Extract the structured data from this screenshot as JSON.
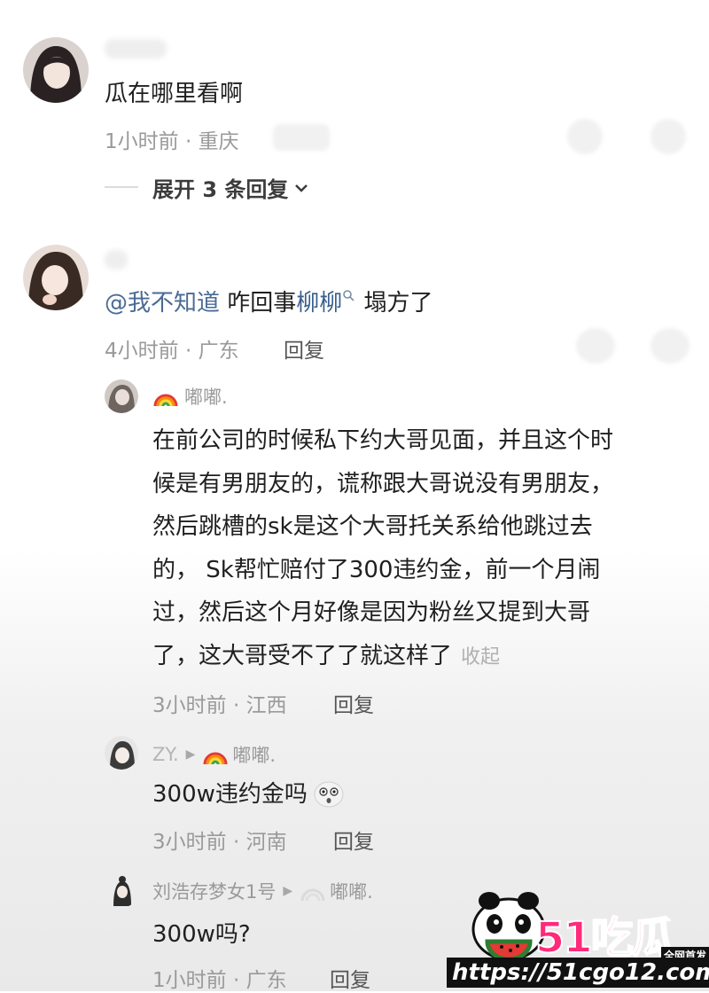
{
  "comments": [
    {
      "text": "瓜在哪里看啊",
      "meta": "1小时前 · 重庆",
      "expand_label": "展开 3 条回复"
    },
    {
      "mention": "@我不知道",
      "text_before_link": " 咋回事",
      "link": "柳柳",
      "text_after_link": " 塌方了",
      "meta": "4小时前 · 广东",
      "reply": "回复"
    }
  ],
  "replies": [
    {
      "name": "嘟嘟.",
      "lines": [
        "在前公司的时候私下约大哥见面，并且这个时",
        "候是有男朋友的，谎称跟大哥说没有男朋友，",
        "然后跳槽的sk是这个大哥托关系给他跳过去",
        "的， Sk帮忙赔付了300违约金，前一个月闹",
        "过，然后这个月好像是因为粉丝又提到大哥",
        "了，这大哥受不了了就这样了"
      ],
      "collapse": "收起",
      "meta": "3小时前 · 江西",
      "reply": "回复"
    },
    {
      "name": "ZY.",
      "to": "嘟嘟.",
      "text": "300w违约金吗",
      "meta": "3小时前 · 河南",
      "reply": "回复"
    },
    {
      "name": "刘浩存梦女1号",
      "to": "嘟嘟.",
      "text": "300w吗?",
      "meta": "1小时前 · 广东",
      "reply": "回复"
    }
  ],
  "watermark": {
    "logo_text": "51吃瓜",
    "badge": "全网首发",
    "url": "https://51cgo12.com"
  },
  "icons": [
    "chevron-down-icon",
    "search-icon",
    "rainbow-emoji-icon",
    "reply-arrow-icon",
    "shocked-face-emoji-icon"
  ]
}
